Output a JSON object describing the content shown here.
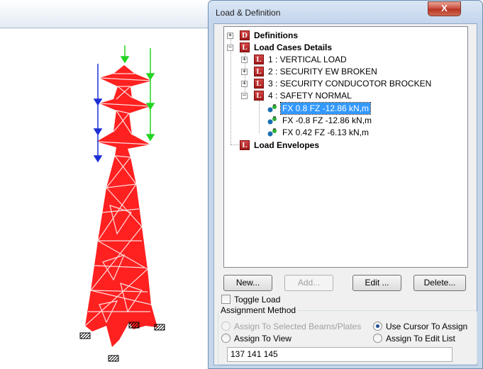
{
  "dialog": {
    "title": "Load & Definition",
    "close_label": "X"
  },
  "tree": {
    "definitions": "Definitions",
    "load_cases_details": "Load Cases Details",
    "cases": [
      "1 : VERTICAL LOAD",
      "2 : SECURITY EW BROKEN",
      "3 : SECURITY CONDUCOTOR BROCKEN",
      "4 : SAFETY NORMAL"
    ],
    "loads": [
      "FX 0.8 FZ -12.86 kN,m",
      "FX -0.8 FZ -12.86 kN,m",
      "FX 0.42 FZ -6.13 kN,m"
    ],
    "load_envelopes": "Load Envelopes",
    "icon_letter_d": "D",
    "icon_letter_l": "L",
    "expand_plus": "+",
    "expand_minus": "−"
  },
  "buttons": {
    "new": "New...",
    "add": "Add...",
    "edit": "Edit ...",
    "delete": "Delete..."
  },
  "toggle_load": "Toggle Load",
  "assignment": {
    "legend": "Assignment Method",
    "options": [
      "Assign To Selected Beams/Plates",
      "Use Cursor To Assign",
      "Assign To View",
      "Assign To Edit List"
    ],
    "selected": "Use Cursor To Assign",
    "edit_list_value": "137 141 145"
  },
  "colors": {
    "tower": "#ff2020",
    "load_blue": "#1c2fd6",
    "load_green": "#22d422",
    "selection": "#3399ff"
  }
}
